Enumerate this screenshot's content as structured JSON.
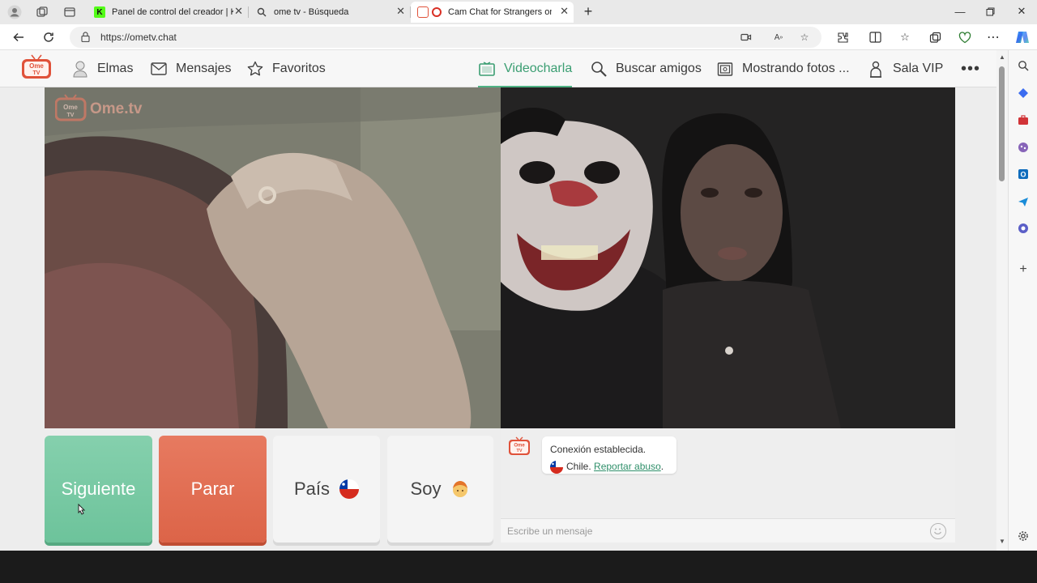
{
  "browser": {
    "tabs": [
      {
        "title": "Panel de control del creador | Kick"
      },
      {
        "title": "ome tv - Búsqueda"
      },
      {
        "title": "Cam Chat for Strangers on OmeTV"
      }
    ],
    "address": {
      "url": "https://ometv.chat"
    }
  },
  "site": {
    "nav": {
      "profile": "Elmas",
      "messages": "Mensajes",
      "favorites": "Favoritos",
      "videochat": "Videocharla",
      "find_friends": "Buscar amigos",
      "photos": "Mostrando fotos ...",
      "vip": "Sala VIP"
    },
    "watermark": "Ome.tv",
    "logo_text": {
      "line1": "Ome",
      "line2": "TV"
    },
    "accent_color": "#4fb284",
    "stop_color": "#dc6448"
  },
  "controls": {
    "next": "Siguiente",
    "stop": "Parar",
    "country": "País",
    "gender": "Soy"
  },
  "chat": {
    "status": "Conexión establecida.",
    "country": "Chile.",
    "report_link": "Reportar abuso",
    "report_suffix": ".",
    "placeholder": "Escribe un mensaje"
  }
}
